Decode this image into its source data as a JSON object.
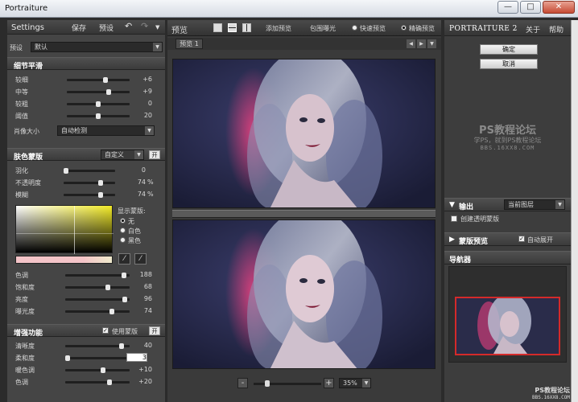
{
  "window": {
    "title": "Portraiture",
    "minimize_icon": "—",
    "maximize_icon": "□",
    "close_icon": "✕"
  },
  "left": {
    "header_title": "Settings",
    "save_label": "保存",
    "preset_label": "预设",
    "undo_icon": "↶",
    "redo_icon": "↷",
    "menu_icon": "▼",
    "preset_row_label": "预设",
    "preset_value": "默认",
    "detail": {
      "title": "细节平滑",
      "sliders": [
        {
          "label": "较细",
          "value": "+6",
          "fraction": 0.62
        },
        {
          "label": "中等",
          "value": "+9",
          "fraction": 0.68
        },
        {
          "label": "较粗",
          "value": "0",
          "fraction": 0.5
        },
        {
          "label": "阈值",
          "value": "20",
          "fraction": 0.5
        }
      ],
      "size_label": "肖像大小",
      "size_value": "自动检测"
    },
    "skin": {
      "title": "肤色蒙版",
      "mode_value": "自定义",
      "toggle_label": "开",
      "sliders": [
        {
          "label": "羽化",
          "value": "0",
          "unit": "",
          "fraction": 0.0
        },
        {
          "label": "不透明度",
          "value": "74",
          "unit": "%",
          "fraction": 0.74
        },
        {
          "label": "模糊",
          "value": "74",
          "unit": "%",
          "fraction": 0.74
        }
      ],
      "show_mask_label": "显示蒙版:",
      "options": [
        {
          "label": "无",
          "selected": true
        },
        {
          "label": "白色",
          "selected": false
        },
        {
          "label": "黑色",
          "selected": false
        }
      ],
      "color_sliders": [
        {
          "label": "色调",
          "value": "188",
          "fraction": 0.94
        },
        {
          "label": "饱和度",
          "value": "68",
          "fraction": 0.68
        },
        {
          "label": "亮度",
          "value": "96",
          "fraction": 0.96
        },
        {
          "label": "曝光度",
          "value": "74",
          "fraction": 0.74
        }
      ]
    },
    "enhance": {
      "title": "增强功能",
      "use_mask_label": "使用蒙版",
      "use_mask_checked": true,
      "toggle_label": "开",
      "sliders": [
        {
          "label": "清晰度",
          "value": "40",
          "fraction": 0.9
        },
        {
          "label": "柔和度",
          "value": "3",
          "fraction": 0.0
        },
        {
          "label": "暖色调",
          "value": "+10",
          "fraction": 0.6
        },
        {
          "label": "色调",
          "value": "+20",
          "fraction": 0.7
        }
      ]
    }
  },
  "center": {
    "preview_label": "预览",
    "add_preview_label": "添加预览",
    "clip_exposure_label": "包围曝光",
    "fast_preview_label": "快速预览",
    "accurate_preview_label": "精确预览",
    "accurate_selected": true,
    "tab_label": "预览 1",
    "zoom_out_label": "-",
    "zoom_in_label": "+",
    "zoom_value": "35%",
    "zoom_fraction": 0.18
  },
  "right": {
    "brand_prefix": "PORTRAIT",
    "brand_suffix": "URE 2",
    "about_label": "关于",
    "help_label": "帮助",
    "ok_label": "确定",
    "cancel_label": "取消",
    "watermark_title": "PS教程论坛",
    "watermark_sub": "学PS，就到PS教程论坛",
    "watermark_url": "BBS.16XX8.COM",
    "output_label": "输出",
    "output_value": "当前图层",
    "create_mask_label": "创建透明蒙版",
    "mask_preview_label": "蒙版预览",
    "auto_expand_label": "自动展开",
    "navigator_label": "导航器"
  },
  "footer_watermark": "PS教程论坛",
  "footer_watermark_url": "BBS.16XX8.COM",
  "colors": {
    "accent_red": "#d42a2a",
    "photo_bg": "#2a2c4a",
    "gradient_yellow": "#f2ea28",
    "skin_swatch": "#f4c4c8"
  }
}
